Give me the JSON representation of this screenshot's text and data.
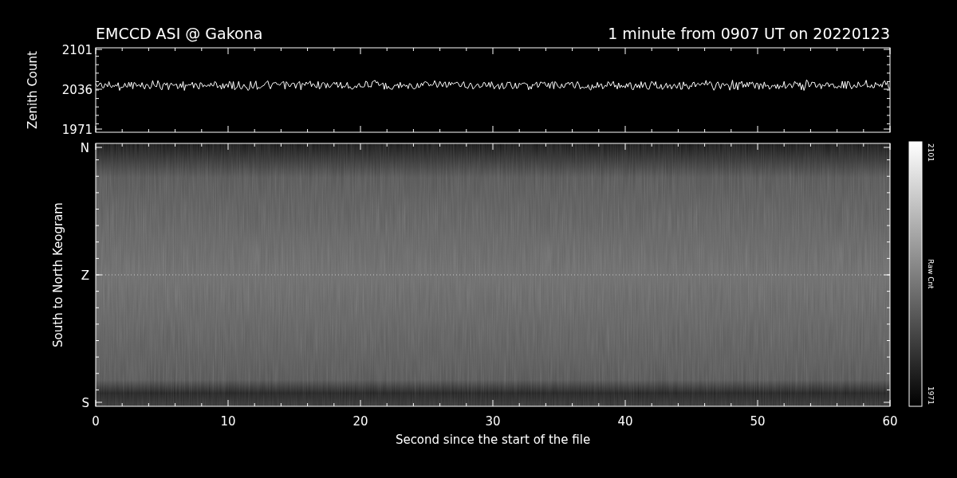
{
  "title": "EMCCD ASI @ Gakona",
  "subtitle": "1 minute from 0907 UT on 20220123",
  "zenith_plot": {
    "ylabel": "Zenith Count",
    "yticks": [
      "2101",
      "2036",
      "1971"
    ]
  },
  "keogram": {
    "ylabel": "South to North Keogram",
    "yticks": [
      "N",
      "Z",
      "S"
    ],
    "xticks": [
      "0",
      "10",
      "20",
      "30",
      "40",
      "50",
      "60"
    ],
    "xlabel": "Second since the start of the file"
  },
  "colorbar": {
    "max": "2101",
    "label": "Raw Cnt",
    "min": "1971"
  }
}
